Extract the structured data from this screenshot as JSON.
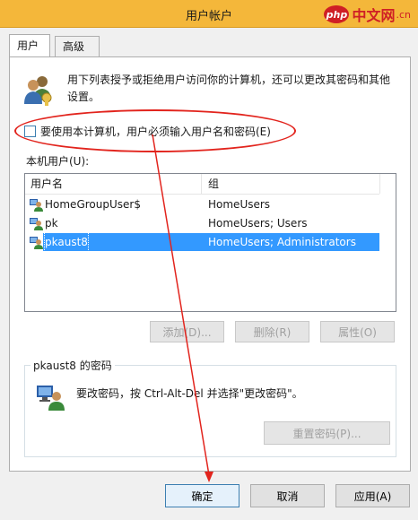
{
  "window": {
    "title": "用户帐户"
  },
  "watermark": {
    "php": "php",
    "cn": "中文网",
    "dotcn": ".cn"
  },
  "tabs": [
    {
      "label": "用户",
      "active": true
    },
    {
      "label": "高级",
      "active": false
    }
  ],
  "description": "用下列表授予或拒绝用户访问你的计算机，还可以更改其密码和其他设置。",
  "checkbox": {
    "label": "要使用本计算机，用户必须输入用户名和密码(E)",
    "checked": false
  },
  "local_users": {
    "label": "本机用户(U):",
    "columns": [
      "用户名",
      "组"
    ],
    "rows": [
      {
        "name": "HomeGroupUser$",
        "group": "HomeUsers",
        "selected": false
      },
      {
        "name": "pk",
        "group": "HomeUsers; Users",
        "selected": false
      },
      {
        "name": "pkaust8",
        "group": "HomeUsers; Administrators",
        "selected": true
      }
    ]
  },
  "buttons": {
    "add": "添加(D)...",
    "remove": "删除(R)",
    "properties": "属性(O)"
  },
  "password_group": {
    "legend": "pkaust8 的密码",
    "text": "要改密码，按 Ctrl-Alt-Del 并选择\"更改密码\"。",
    "reset_button": "重置密码(P)..."
  },
  "footer": {
    "ok": "确定",
    "cancel": "取消",
    "apply": "应用(A)"
  },
  "colors": {
    "titlebar": "#f4b73a",
    "selection": "#3399ff",
    "annotation": "#e2241d"
  }
}
